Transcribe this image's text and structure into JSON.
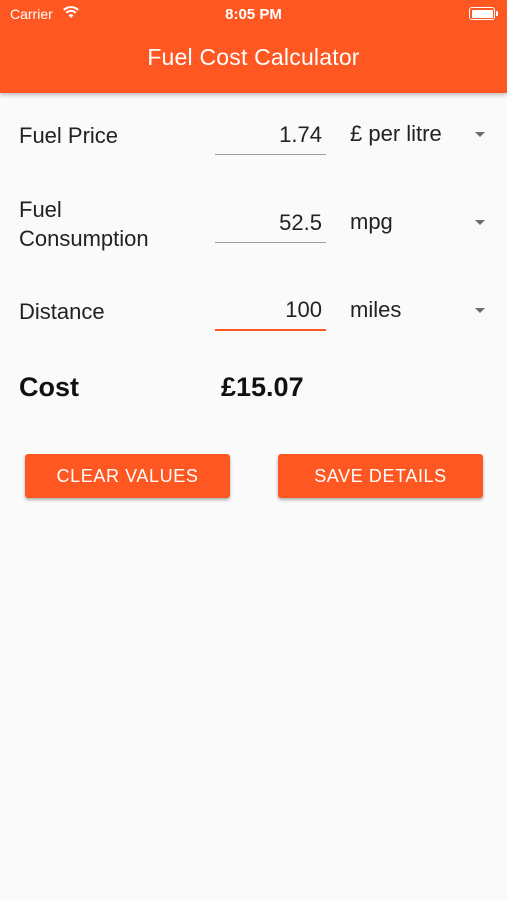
{
  "status_bar": {
    "carrier": "Carrier",
    "time": "8:05 PM",
    "wifi_icon": "wifi-icon",
    "battery_icon": "battery-icon"
  },
  "app_bar": {
    "title": "Fuel Cost Calculator",
    "color": "#ff5722"
  },
  "form": {
    "fuel_price": {
      "label": "Fuel Price",
      "value": "1.74",
      "unit": "£ per litre"
    },
    "fuel_consumption": {
      "label_line1": "Fuel",
      "label_line2": "Consumption",
      "value": "52.5",
      "unit": "mpg"
    },
    "distance": {
      "label": "Distance",
      "value": "100",
      "unit": "miles",
      "focused": true
    }
  },
  "result": {
    "label": "Cost",
    "value": "£15.07"
  },
  "buttons": {
    "clear": "CLEAR VALUES",
    "save": "SAVE DETAILS"
  }
}
